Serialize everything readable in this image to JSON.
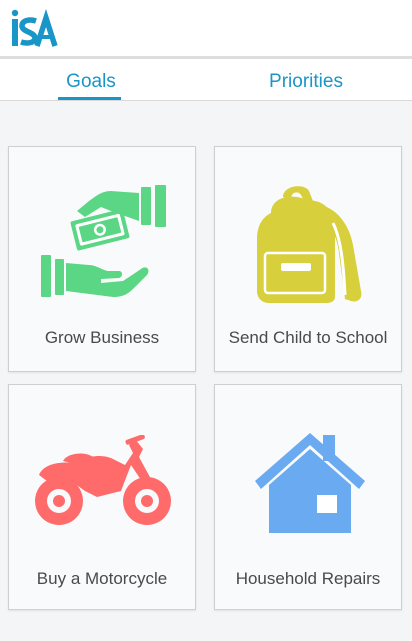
{
  "app": {
    "logo_text": "ISA"
  },
  "tabs": [
    {
      "label": "Goals",
      "active": true
    },
    {
      "label": "Priorities",
      "active": false
    }
  ],
  "goals": [
    {
      "label": "Grow Business",
      "icon": "money-hand-icon",
      "color": "#5bd684"
    },
    {
      "label": "Send Child to School",
      "icon": "backpack-icon",
      "color": "#d8cf3d"
    },
    {
      "label": "Buy a Motorcycle",
      "icon": "motorcycle-icon",
      "color": "#ff6b6b"
    },
    {
      "label": "Household Repairs",
      "icon": "house-icon",
      "color": "#6aaaf0"
    }
  ],
  "colors": {
    "accent": "#1a95c7",
    "background": "#f4f5f7"
  }
}
